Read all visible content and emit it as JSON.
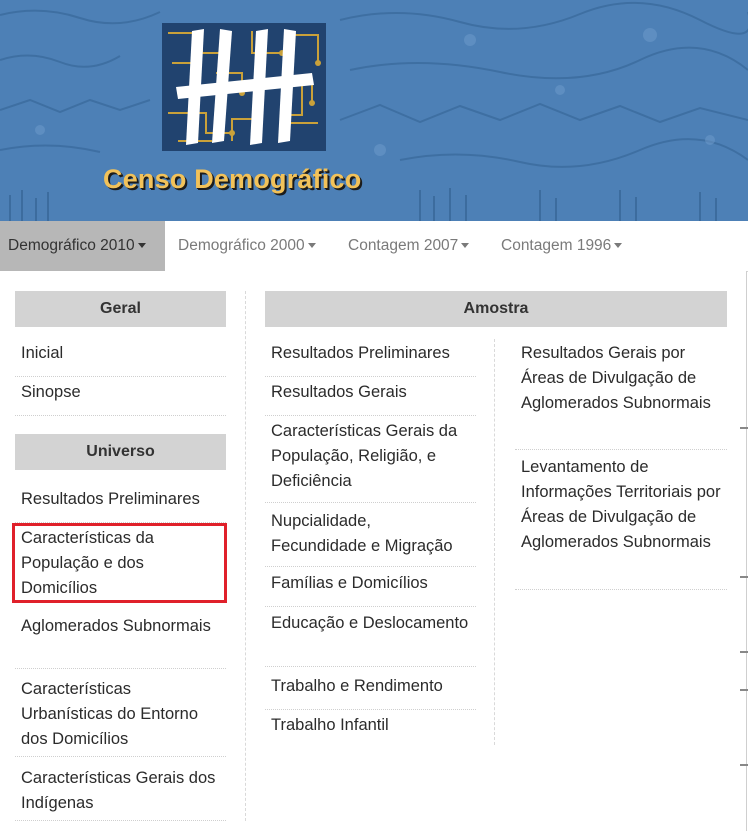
{
  "header": {
    "title": "Censo Demográfico",
    "logo_icon": "census-tally-logo-icon",
    "colors": {
      "banner": "#4d80b6",
      "title": "#f2c25a"
    }
  },
  "nav": {
    "tabs": [
      {
        "label": "Demográfico 2010",
        "active": true
      },
      {
        "label": "Demográfico 2000",
        "active": false
      },
      {
        "label": "Contagem 2007",
        "active": false
      },
      {
        "label": "Contagem 1996",
        "active": false
      }
    ]
  },
  "menu": {
    "geral": {
      "header": "Geral",
      "items": [
        "Inicial",
        "Sinopse"
      ]
    },
    "universo": {
      "header": "Universo",
      "items": [
        "Resultados Preliminares",
        "Características da População e dos Domicílios",
        "Aglomerados Subnormais",
        "Características Urbanísticas do Entorno dos Domicílios",
        "Características Gerais dos Indígenas"
      ]
    },
    "amostra": {
      "header": "Amostra",
      "col1": [
        "Resultados Preliminares",
        "Resultados Gerais",
        "Características Gerais da População, Religião, e Deficiência",
        "Nupcialidade, Fecundidade e Migração",
        "Famílias e Domicílios",
        "Educação e Deslocamento",
        "Trabalho e Rendimento",
        "Trabalho Infantil"
      ],
      "col2": [
        "Resultados Gerais por Áreas de Divulgação de Aglomerados Subnormais",
        "Levantamento de Informações Territoriais por Áreas de Divulgação de Aglomerados Subnormais"
      ]
    },
    "highlight_color": "#e0202a"
  }
}
